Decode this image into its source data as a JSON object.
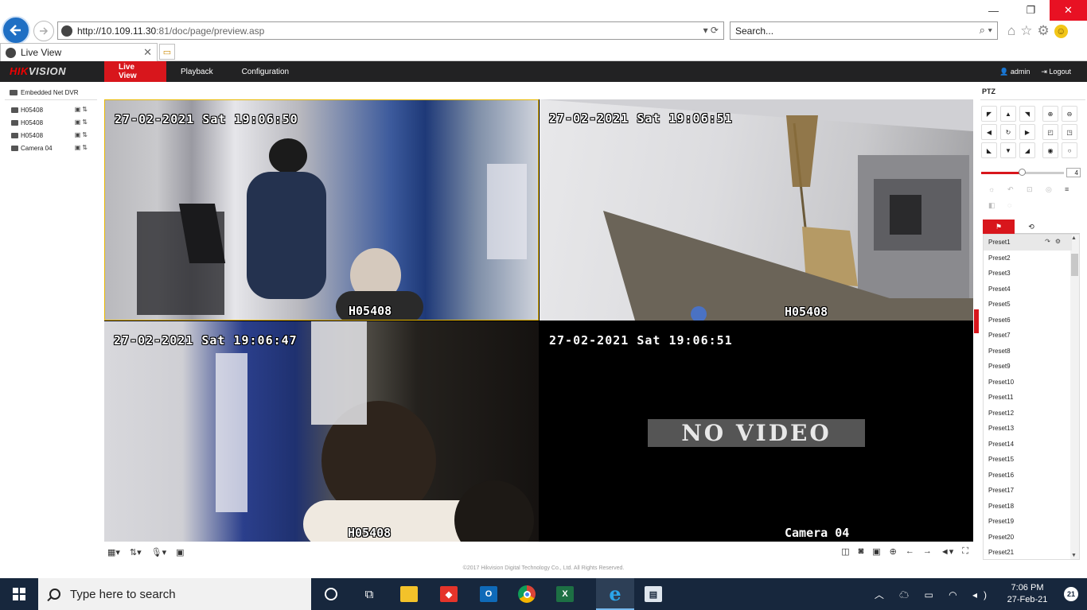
{
  "browser": {
    "url_host": "http://10.109.11.30",
    "url_rest": ":81/doc/page/preview.asp",
    "search_placeholder": "Search...",
    "tab_title": "Live View"
  },
  "app": {
    "logo_main": "HIK",
    "logo_rest": "VISION",
    "menu": [
      "Live View",
      "Playback",
      "Configuration"
    ],
    "user": "admin",
    "logout": "Logout",
    "footer": "©2017 Hikvision Digital Technology Co., Ltd. All Rights Reserved."
  },
  "tree": {
    "root": "Embedded Net DVR",
    "cameras": [
      "H05408",
      "H05408",
      "H05408",
      "Camera 04"
    ]
  },
  "tiles": [
    {
      "osd": "27-02-2021 Sat 19:06:50",
      "name": "H05408",
      "selected": true
    },
    {
      "osd": "27-02-2021 Sat 19:06:51",
      "name": "H05408"
    },
    {
      "osd": "27-02-2021 Sat 19:06:47",
      "name": "H05408"
    },
    {
      "osd": "27-02-2021 Sat 19:06:51",
      "name": "Camera 04",
      "status": "NO VIDEO"
    }
  ],
  "ptz": {
    "title": "PTZ",
    "speed": "4",
    "speed_level": 0.5,
    "presets": [
      "Preset1",
      "Preset2",
      "Preset3",
      "Preset4",
      "Preset5",
      "Preset6",
      "Preset7",
      "Preset8",
      "Preset9",
      "Preset10",
      "Preset11",
      "Preset12",
      "Preset13",
      "Preset14",
      "Preset15",
      "Preset16",
      "Preset17",
      "Preset18",
      "Preset19",
      "Preset20",
      "Preset21"
    ]
  },
  "taskbar": {
    "search_placeholder": "Type here to search",
    "time": "7:06 PM",
    "date": "27-Feb-21",
    "notification_count": "21",
    "apps": [
      "cortana-icon",
      "task-view-icon",
      "file-explorer-icon",
      "anydesk-icon",
      "outlook-icon",
      "chrome-icon",
      "excel-icon",
      "internet-explorer-icon",
      "remote-app-icon"
    ]
  },
  "colors": {
    "accent": "#d8161c",
    "header_bg": "#222223",
    "selected_tile_border": "#e8b800",
    "taskbar_bg": "#17273d"
  }
}
